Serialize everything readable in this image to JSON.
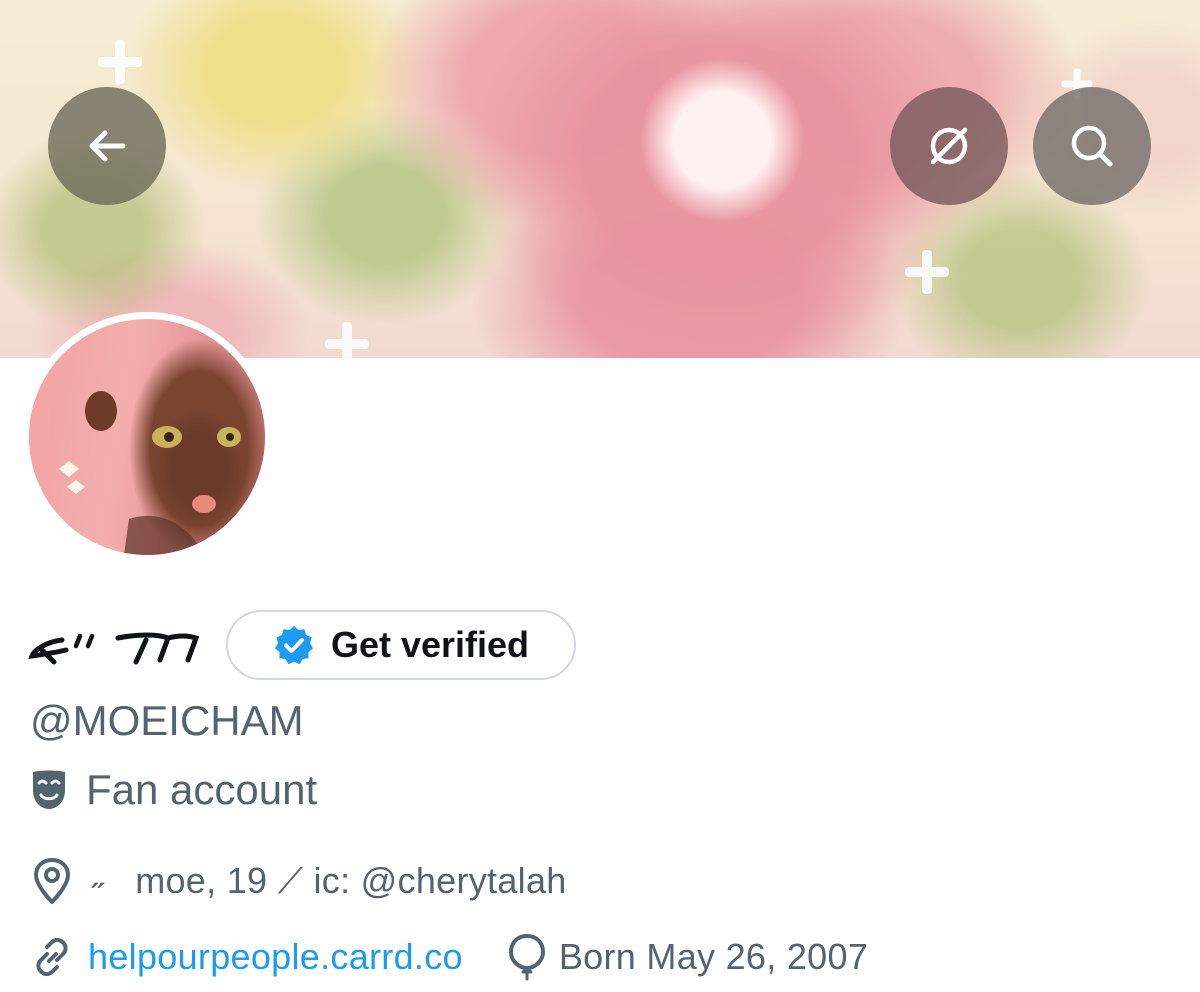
{
  "header": {
    "back_button_icon": "arrow-left-icon",
    "translate_button_icon": "translate-off-icon",
    "search_button_icon": "search-icon"
  },
  "profile": {
    "display_name_glyphs": "ᕙ\" ᒉ",
    "verify_button_label": "Get verified",
    "verify_icon": "verified-badge-icon",
    "verify_color": "#1d9bf0",
    "handle": "@MOEICHAM",
    "category_icon": "theater-masks-icon",
    "category": "Fan account",
    "location_icon": "location-pin-icon",
    "location": "˶   moe, 19 ⟋ ic: @cherytalah",
    "link_icon": "link-icon",
    "link": "helpourpeople.carrd.co",
    "link_color": "#1d9bf0",
    "birthday_icon": "balloon-icon",
    "birthday": "Born May 26, 2007"
  }
}
